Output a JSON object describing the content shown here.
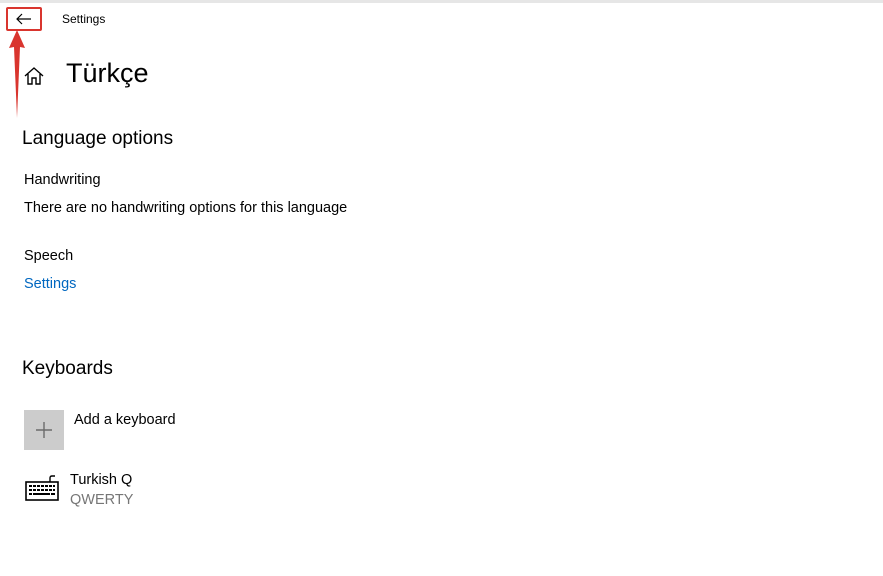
{
  "window": {
    "app_title": "Settings",
    "back_icon": "arrow-left-icon"
  },
  "annotation": {
    "color": "#d9352e",
    "icon": "red-up-arrow"
  },
  "header": {
    "home_icon": "home-icon",
    "page_title": "Türkçe"
  },
  "language_options": {
    "heading": "Language options",
    "handwriting": {
      "label": "Handwriting",
      "description": "There are no handwriting options for this language"
    },
    "speech": {
      "label": "Speech",
      "settings_link": "Settings"
    }
  },
  "keyboards": {
    "heading": "Keyboards",
    "add_keyboard_label": "Add a keyboard",
    "add_icon": "plus-icon",
    "items": [
      {
        "name": "Turkish Q",
        "layout": "QWERTY",
        "icon": "keyboard-icon"
      }
    ]
  },
  "colors": {
    "accent_link": "#0067c0",
    "tile_gray": "#cccccc",
    "secondary_text": "#767676"
  }
}
